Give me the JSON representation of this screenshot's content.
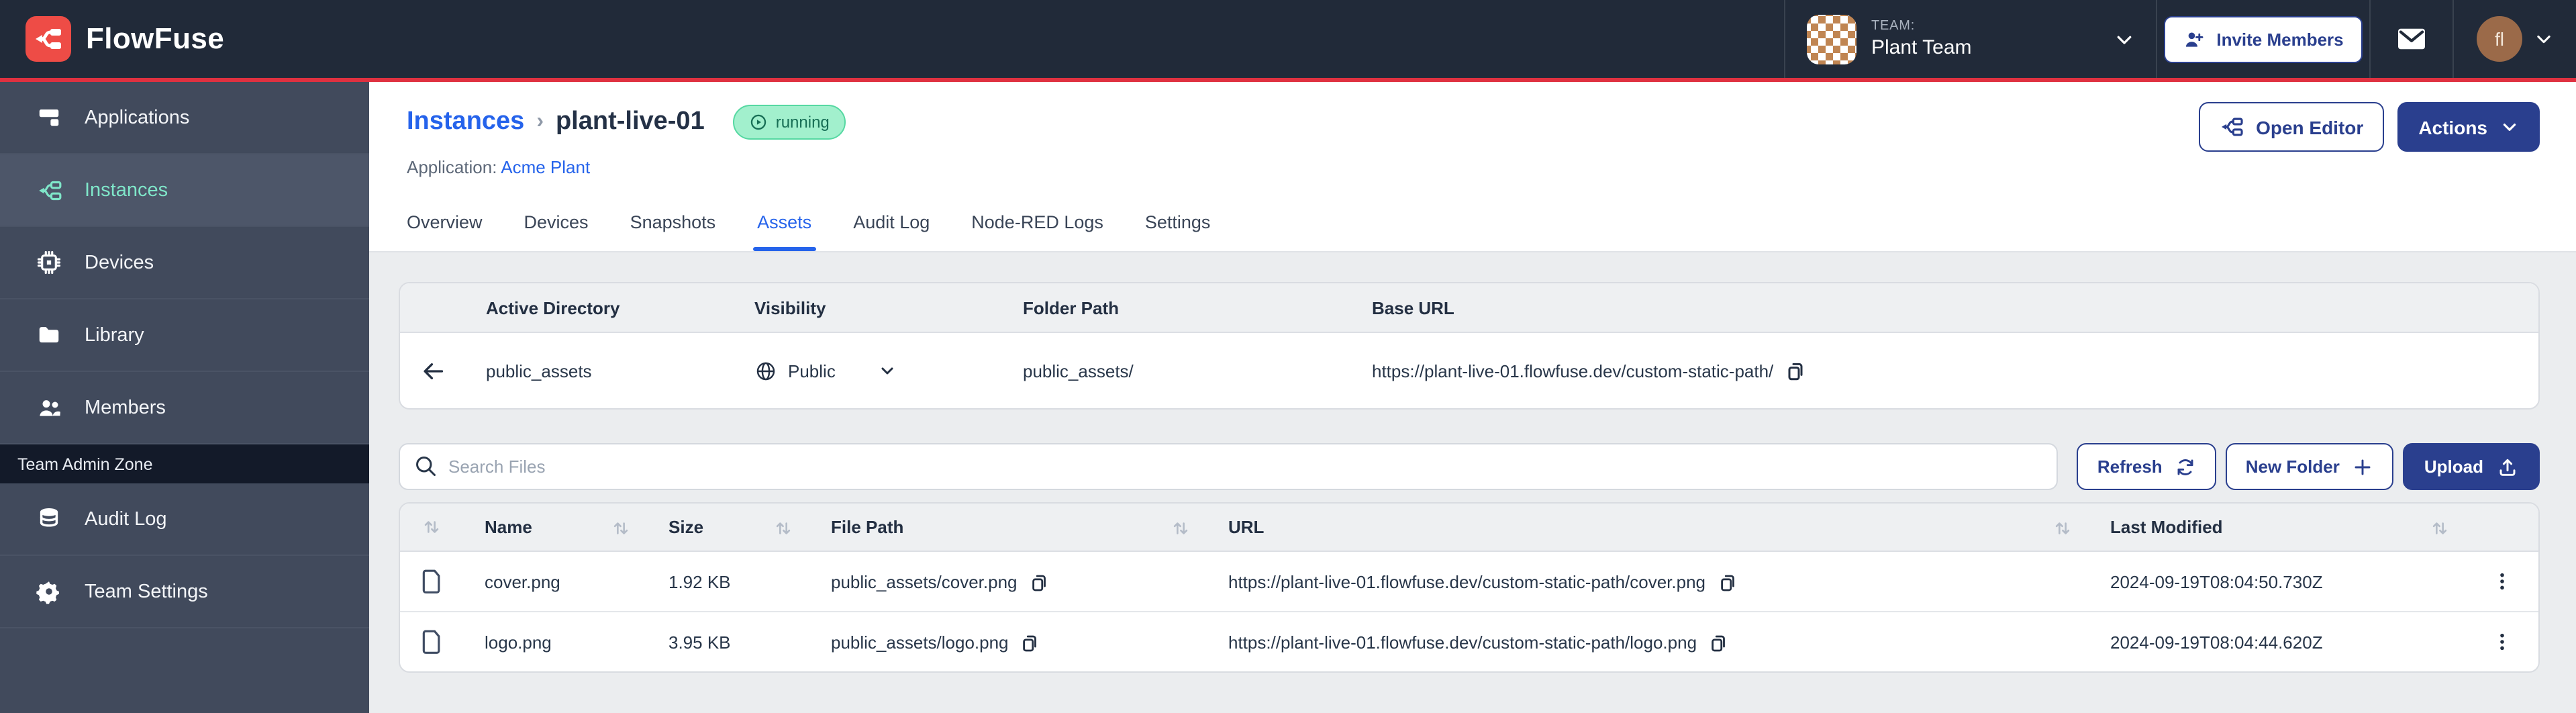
{
  "topbar": {
    "brand": "FlowFuse",
    "team": {
      "label": "TEAM:",
      "name": "Plant Team"
    },
    "invite_button": "Invite Members",
    "user_initials": "fl"
  },
  "sidebar": {
    "items": [
      "Applications",
      "Instances",
      "Devices",
      "Library",
      "Members"
    ],
    "active_item": "Instances",
    "admin_zone_label": "Team Admin Zone",
    "admin_items": [
      "Audit Log",
      "Team Settings"
    ]
  },
  "header": {
    "breadcrumb": {
      "root": "Instances",
      "separator": "›",
      "current": "plant-live-01"
    },
    "status_badge": "running",
    "application_label": "Application:",
    "application_name": "Acme Plant",
    "open_editor_button": "Open Editor",
    "actions_button": "Actions"
  },
  "tabs": {
    "items": [
      "Overview",
      "Devices",
      "Snapshots",
      "Assets",
      "Audit Log",
      "Node-RED Logs",
      "Settings"
    ],
    "active": "Assets"
  },
  "directory_panel": {
    "columns": [
      "Active Directory",
      "Visibility",
      "Folder Path",
      "Base URL"
    ],
    "row": {
      "name": "public_assets",
      "visibility": "Public",
      "folder_path": "public_assets/",
      "base_url": "https://plant-live-01.flowfuse.dev/custom-static-path/"
    }
  },
  "files_panel": {
    "search_placeholder": "Search Files",
    "refresh_button": "Refresh",
    "new_folder_button": "New Folder",
    "upload_button": "Upload",
    "columns": [
      "Name",
      "Size",
      "File Path",
      "URL",
      "Last Modified"
    ],
    "rows": [
      {
        "name": "cover.png",
        "size": "1.92 KB",
        "file_path": "public_assets/cover.png",
        "url": "https://plant-live-01.flowfuse.dev/custom-static-path/cover.png",
        "last_modified": "2024-09-19T08:04:50.730Z"
      },
      {
        "name": "logo.png",
        "size": "3.95 KB",
        "file_path": "public_assets/logo.png",
        "url": "https://plant-live-01.flowfuse.dev/custom-static-path/logo.png",
        "last_modified": "2024-09-19T08:04:44.620Z"
      }
    ]
  },
  "icons": {
    "logo": "fork-junction",
    "applications": "window-columns",
    "instances": "fork-junction",
    "devices": "cpu-chip",
    "library": "folder",
    "members": "two-users",
    "audit_log": "database",
    "team_settings": "gear",
    "invite": "user-plus",
    "mail": "envelope",
    "user_menu": "chevron-down",
    "status": "play-circle",
    "search": "magnifier",
    "refresh": "sync-arrows",
    "new_folder": "plus",
    "upload": "arrow-up-tray",
    "visibility": "globe",
    "back": "arrow-left",
    "copy": "copy-sheets",
    "file": "document",
    "sort": "up-down-arrows",
    "row_menu": "kebab-dots"
  },
  "colors": {
    "topbar_bg": "#212a39",
    "accent_line": "#df3140",
    "brand_red": "#ee4c46",
    "sidebar_bg": "#414a5c",
    "sidebar_active_bg": "#4d5669",
    "sidebar_active_text": "#7fe6c9",
    "admin_zone_bg": "#131a29",
    "link_blue": "#2563eb",
    "primary_navy": "#2a3f8e",
    "badge_bg": "#a2f0cd",
    "badge_border": "#56d8a2",
    "badge_text": "#176e55",
    "content_bg": "#ebedef"
  }
}
